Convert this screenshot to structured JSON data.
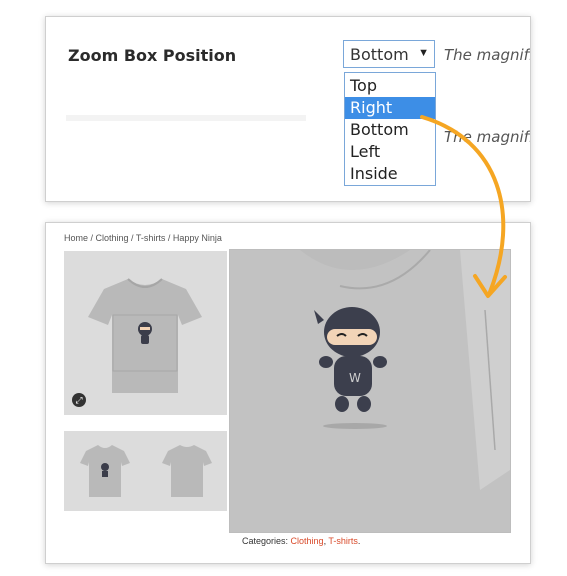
{
  "settings": {
    "label": "Zoom Box Position",
    "select_value": "Bottom",
    "hint_text": "The magnifi",
    "hint_text_2": "The magnifie",
    "options": [
      "Top",
      "Right",
      "Bottom",
      "Left",
      "Inside"
    ],
    "highlighted_option": "Right"
  },
  "product": {
    "breadcrumb": "Home / Clothing / T-shirts / Happy Ninja",
    "categories_label": "Categories: ",
    "categories": [
      "Clothing",
      "T-shirts"
    ],
    "separator": ", ",
    "end": "."
  },
  "colors": {
    "accent_arrow": "#f5a623",
    "highlight": "#3d8ee6",
    "link": "#d94a2a",
    "shirt": "#b9b9b9"
  }
}
